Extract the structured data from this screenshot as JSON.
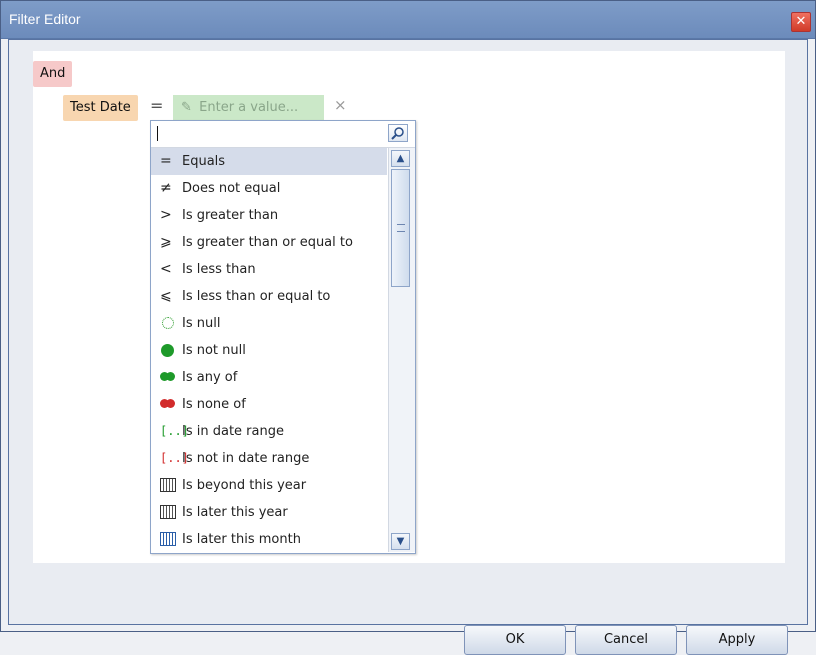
{
  "window": {
    "title": "Filter Editor",
    "close_label": "✕"
  },
  "tree": {
    "group_operator": "And",
    "condition": {
      "field": "Test Date",
      "operator_symbol": "=",
      "value_placeholder": "Enter a value...",
      "remove_symbol": "×"
    }
  },
  "operator_list": {
    "search_value": "",
    "items": [
      {
        "label": "Equals",
        "icon": "equals-icon",
        "glyph": "="
      },
      {
        "label": "Does not equal",
        "icon": "not-equal-icon",
        "glyph": "≠"
      },
      {
        "label": "Is greater than",
        "icon": "greater-than-icon",
        "glyph": ">"
      },
      {
        "label": "Is greater than or equal to",
        "icon": "greater-or-equal-icon",
        "glyph": "⩾"
      },
      {
        "label": "Is less than",
        "icon": "less-than-icon",
        "glyph": "<"
      },
      {
        "label": "Is less than or equal to",
        "icon": "less-or-equal-icon",
        "glyph": "⩽"
      },
      {
        "label": "Is null",
        "icon": "dotted-circle-icon",
        "glyph": ""
      },
      {
        "label": "Is not null",
        "icon": "green-dot-icon",
        "glyph": ""
      },
      {
        "label": "Is any of",
        "icon": "green-dots-icon",
        "glyph": ""
      },
      {
        "label": "Is none of",
        "icon": "red-dots-icon",
        "glyph": ""
      },
      {
        "label": "Is in date range",
        "icon": "date-range-green-icon",
        "glyph": "[..]"
      },
      {
        "label": "Is not in date range",
        "icon": "date-range-red-icon",
        "glyph": "[..]"
      },
      {
        "label": "Is beyond this year",
        "icon": "calendar-icon",
        "glyph": ""
      },
      {
        "label": "Is later this year",
        "icon": "calendar-icon",
        "glyph": ""
      },
      {
        "label": "Is later this month",
        "icon": "calendar-blue-icon",
        "glyph": ""
      }
    ],
    "selected_index": 0
  },
  "buttons": {
    "ok": "OK",
    "cancel": "Cancel",
    "apply": "Apply"
  },
  "colors": {
    "titlebar": "#7e9cc8",
    "group_node": "#f6c9c9",
    "field_node": "#f8d6b0",
    "value_node": "#cbe8c8",
    "green": "#1e9a2a",
    "red": "#d22c2c"
  }
}
